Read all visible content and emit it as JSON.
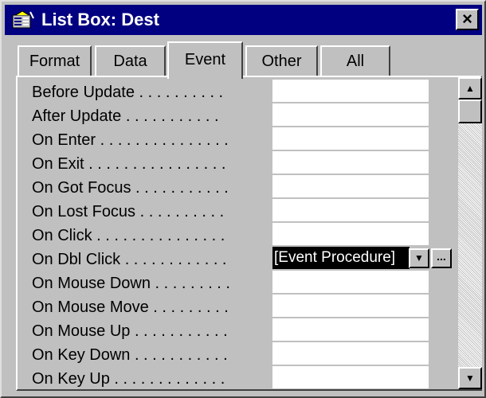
{
  "window": {
    "title": "List Box: Dest",
    "icon": "property-sheet-icon",
    "close_label": "×"
  },
  "tabs": [
    {
      "label": "Format",
      "selected": false
    },
    {
      "label": "Data",
      "selected": false
    },
    {
      "label": "Event",
      "selected": true
    },
    {
      "label": "Other",
      "selected": false
    },
    {
      "label": "All",
      "selected": false
    }
  ],
  "properties": [
    {
      "label": "Before Update . . . . . . . . . .",
      "value": ""
    },
    {
      "label": "After Update . . . . . . . . . . .",
      "value": ""
    },
    {
      "label": "On Enter . . . . . . . . . . . . . . .",
      "value": ""
    },
    {
      "label": "On Exit . . . . . . . . . . . . . . . .",
      "value": ""
    },
    {
      "label": "On Got Focus . . . . . . . . . . .",
      "value": ""
    },
    {
      "label": "On Lost Focus . . . . . . . . . .",
      "value": ""
    },
    {
      "label": "On Click . . . . . . . . . . . . . . .",
      "value": ""
    },
    {
      "label": "On Dbl Click . . . . . . . . . . . .",
      "value": "[Event Procedure]",
      "selected": true
    },
    {
      "label": "On Mouse Down . . . . . . . . .",
      "value": ""
    },
    {
      "label": "On Mouse Move . . . . . . . . .",
      "value": ""
    },
    {
      "label": "On Mouse Up . . . . . . . . . . .",
      "value": ""
    },
    {
      "label": "On Key Down . . . . . . . . . . .",
      "value": ""
    },
    {
      "label": "On Key Up . . . . . . . . . . . . .",
      "value": ""
    }
  ],
  "controls": {
    "dropdown_glyph": "▼",
    "build_glyph": "...",
    "scroll_up_glyph": "▲",
    "scroll_down_glyph": "▼"
  },
  "colors": {
    "titlebar": "#000080",
    "face": "#c0c0c0",
    "selection": "#000000"
  }
}
